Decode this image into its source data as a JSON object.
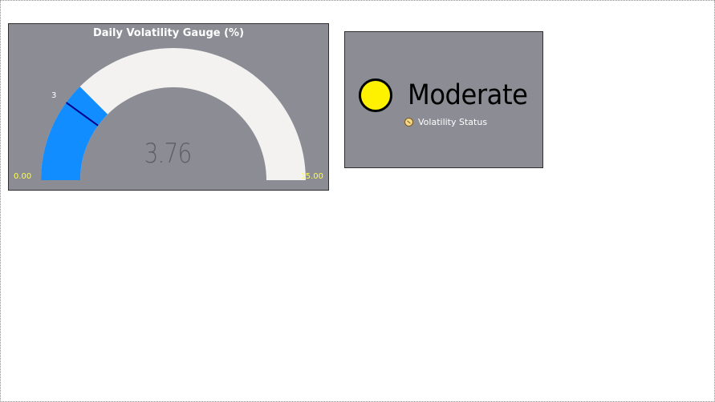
{
  "gauge": {
    "title": "Daily Volatility Gauge (%)",
    "min_label": "0.00",
    "max_label": "15.00",
    "target_label": "3",
    "value_label": "3.76",
    "fill_color": "#118dff",
    "track_color": "#f3f2f0",
    "target_color": "#00008b"
  },
  "status": {
    "value": "Moderate",
    "subtitle": "Volatility Status",
    "indicator_color": "#fff200",
    "icon": "gauge-icon"
  },
  "chart_data": {
    "type": "gauge",
    "title": "Daily Volatility Gauge (%)",
    "min": 0,
    "max": 15,
    "value": 3.76,
    "target": 3
  }
}
